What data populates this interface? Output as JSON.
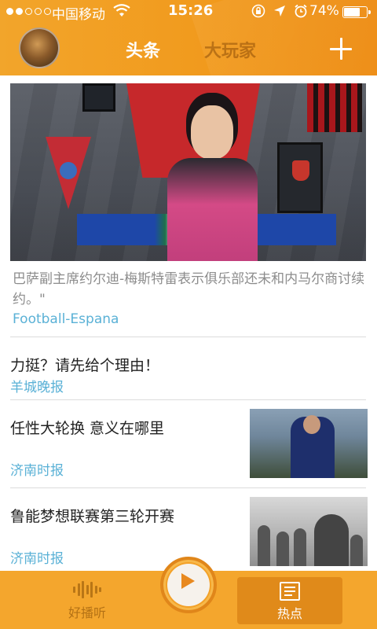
{
  "status_bar": {
    "carrier": "中国移动",
    "time": "15:26",
    "battery": "74%",
    "battery_level": 0.74
  },
  "nav": {
    "tabs": [
      {
        "label": "头条",
        "active": true
      },
      {
        "label": "大玩家",
        "active": false
      }
    ],
    "add_icon": "plus-icon",
    "avatar_icon": "user-avatar"
  },
  "feed": {
    "hero": {
      "caption": "巴萨副主席约尔迪-梅斯特雷表示俱乐部还未和内马尔商讨续约。\"",
      "source": "Football-Espana"
    },
    "items": [
      {
        "title": "力挺？请先给个理由！",
        "source": "羊城晚报"
      },
      {
        "title": "任性大轮换 意义在哪里",
        "source": "济南时报"
      },
      {
        "title": "鲁能梦想联赛第三轮开赛",
        "source": "济南时报"
      }
    ]
  },
  "tabbar": {
    "left_label": "好播听",
    "right_label": "热点",
    "left_icon": "audio-wave-icon",
    "right_icon": "newspaper-icon",
    "center_icon": "play-icon"
  },
  "colors": {
    "header_orange": "#f19a1d",
    "source_blue": "#5ab1d6",
    "tabbar_orange": "#f4a62d",
    "active_tab_bg": "#e08a1a"
  }
}
